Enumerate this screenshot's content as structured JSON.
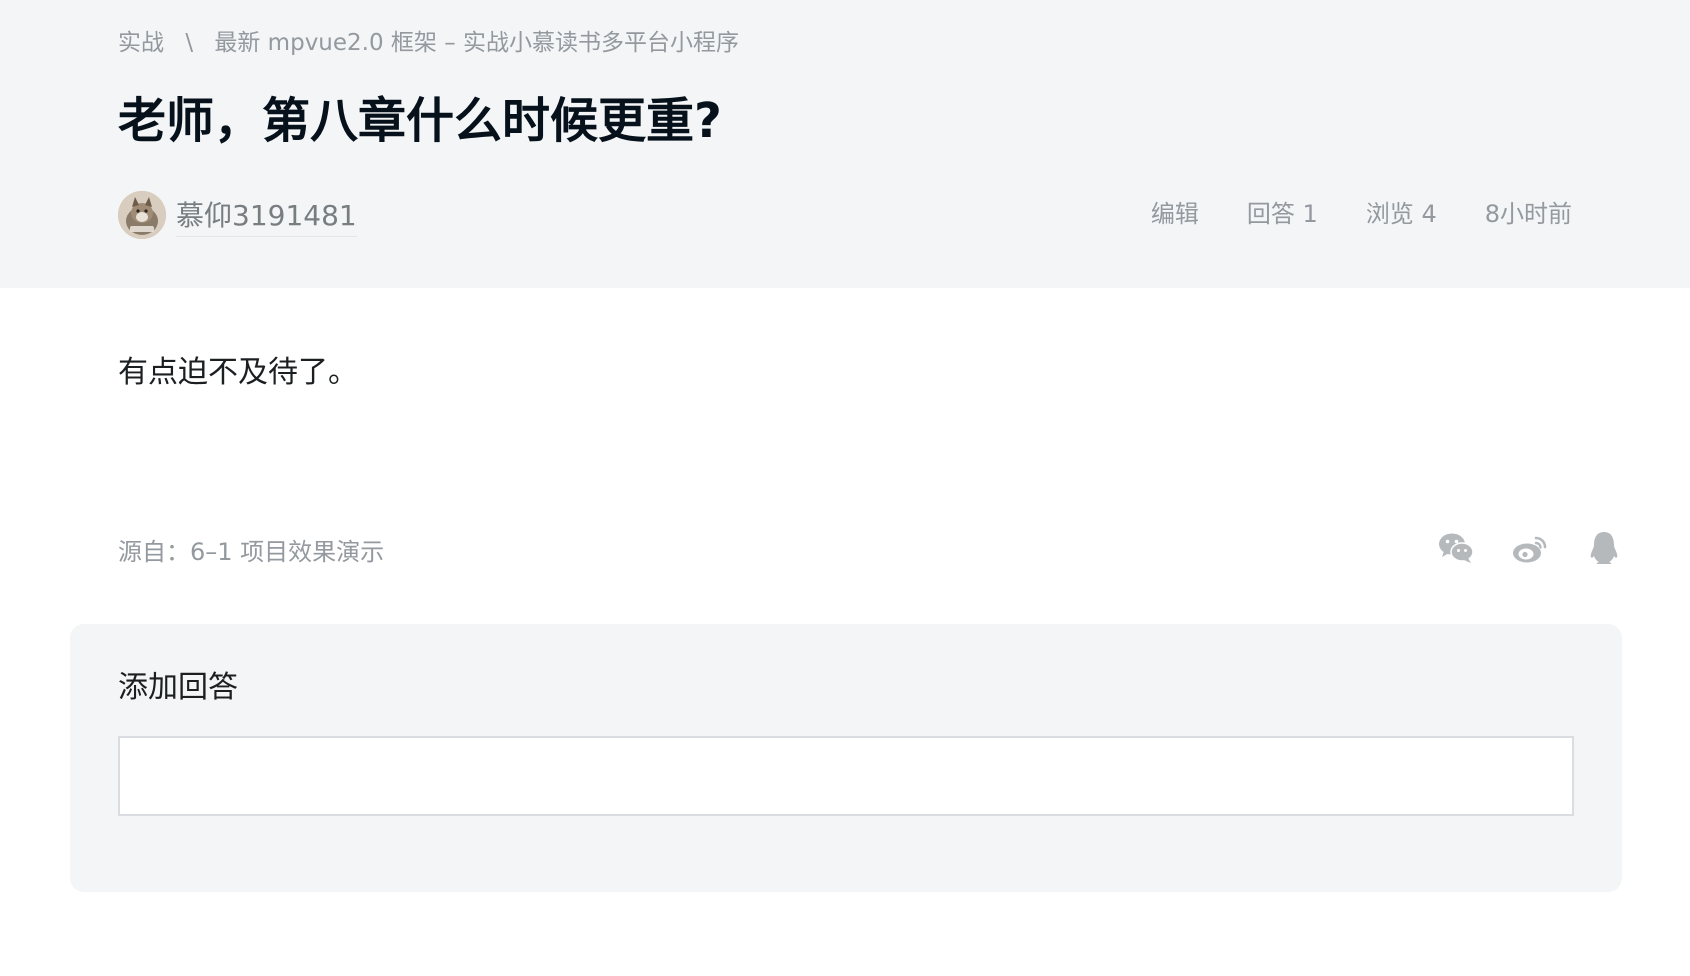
{
  "breadcrumb": {
    "category": "实战",
    "separator": "\\",
    "course": "最新 mpvue2.0 框架 – 实战小慕读书多平台小程序"
  },
  "question": {
    "title": "老师，第八章什么时候更重?",
    "author": "慕仰3191481",
    "body": "有点迫不及待了。"
  },
  "meta": {
    "edit_label": "编辑",
    "answers": "回答 1",
    "views": "浏览 4",
    "time": "8小时前"
  },
  "source": {
    "label": "源自：",
    "lesson": "6–1 项目效果演示"
  },
  "share": {
    "icons": [
      "wechat-icon",
      "weibo-icon",
      "qq-icon"
    ],
    "icon_color": "#b5b9bc"
  },
  "answer": {
    "heading": "添加回答",
    "value": ""
  }
}
